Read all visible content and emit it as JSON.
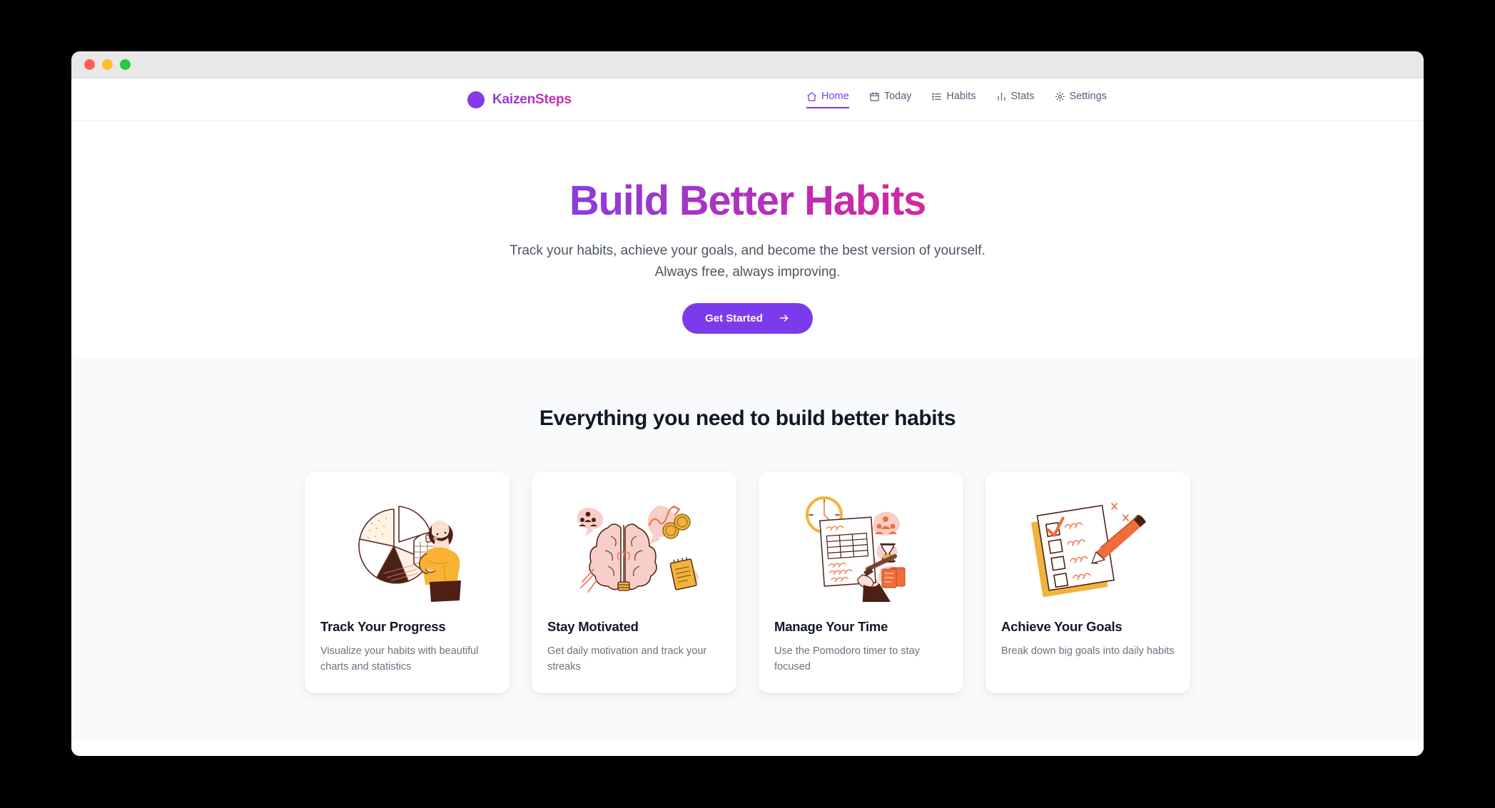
{
  "window": {
    "traffic_lights": [
      "close",
      "minimize",
      "maximize"
    ]
  },
  "header": {
    "brand_name": "KaizenSteps",
    "brand_icon": "circle-logo-icon",
    "nav": [
      {
        "label": "Home",
        "icon": "home-icon",
        "active": true
      },
      {
        "label": "Today",
        "icon": "calendar-icon",
        "active": false
      },
      {
        "label": "Habits",
        "icon": "list-icon",
        "active": false
      },
      {
        "label": "Stats",
        "icon": "bar-chart-icon",
        "active": false
      },
      {
        "label": "Settings",
        "icon": "gear-icon",
        "active": false
      }
    ]
  },
  "hero": {
    "title": "Build Better Habits",
    "subtitle_line1": "Track your habits, achieve your goals, and become the best version of yourself.",
    "subtitle_line2": "Always free, always improving.",
    "cta_label": "Get Started",
    "cta_icon": "arrow-right-icon"
  },
  "features": {
    "section_title": "Everything you need to build better habits",
    "cards": [
      {
        "title": "Track Your Progress",
        "desc": "Visualize your habits with beautiful charts and statistics",
        "art": "pie-chart-person-illustration"
      },
      {
        "title": "Stay Motivated",
        "desc": "Get daily motivation and track your streaks",
        "art": "brain-motivation-illustration"
      },
      {
        "title": "Manage Your Time",
        "desc": "Use the Pomodoro timer to stay focused",
        "art": "clock-schedule-illustration"
      },
      {
        "title": "Achieve Your Goals",
        "desc": "Break down big goals into daily habits",
        "art": "checklist-pencil-illustration"
      }
    ]
  },
  "colors": {
    "accent_purple": "#7c3aed",
    "brand_gradient_start": "#8b3ddb",
    "brand_gradient_end": "#d4269f",
    "page_background": "#f8fafc",
    "text_primary": "#111827",
    "text_muted": "#6b7280",
    "traffic_red": "#ff5f57",
    "traffic_yellow": "#febc2e",
    "traffic_green": "#28c840"
  }
}
